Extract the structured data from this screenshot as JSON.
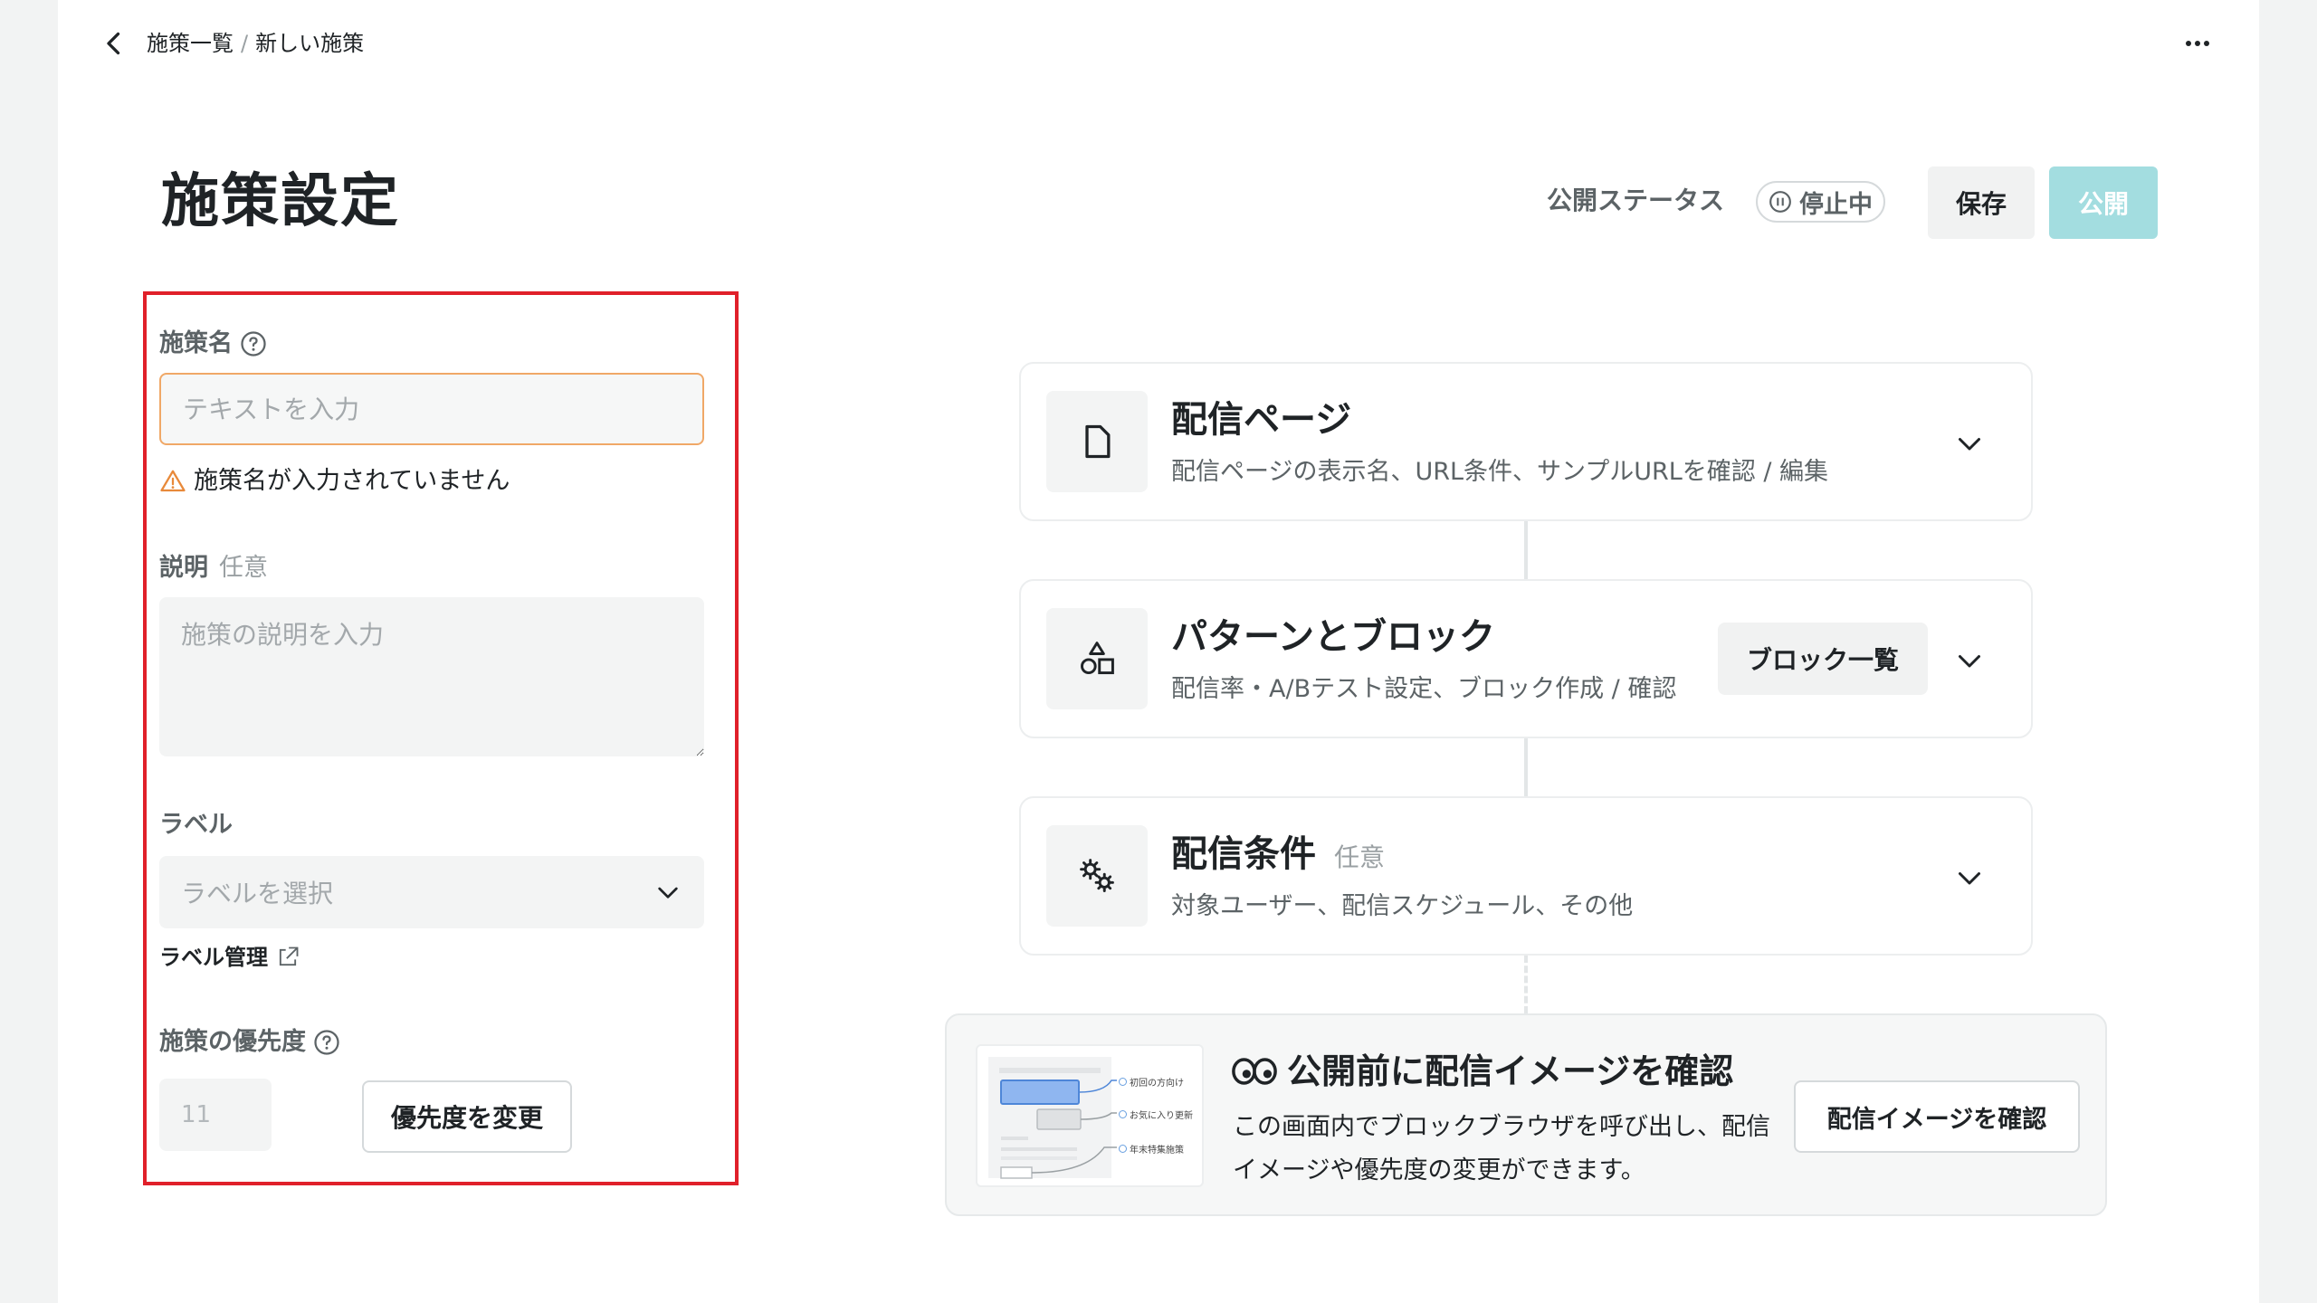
{
  "breadcrumb": {
    "parent": "施策一覧",
    "separator": "/",
    "current": "新しい施策"
  },
  "header": {
    "title": "施策設定",
    "status_label": "公開ステータス",
    "status_value": "停止中",
    "save_label": "保存",
    "publish_label": "公開"
  },
  "form": {
    "name": {
      "label": "施策名",
      "placeholder": "テキストを入力",
      "error": "施策名が入力されていません"
    },
    "description": {
      "label": "説明",
      "optional": "任意",
      "placeholder": "施策の説明を入力"
    },
    "label": {
      "label": "ラベル",
      "placeholder": "ラベルを選択",
      "manage_link": "ラベル管理"
    },
    "priority": {
      "label": "施策の優先度",
      "value": "11",
      "change_button": "優先度を変更"
    }
  },
  "cards": [
    {
      "title": "配信ページ",
      "description": "配信ページの表示名、URL条件、サンプルURLを確認 / 編集",
      "icon": "document-icon"
    },
    {
      "title": "パターンとブロック",
      "description": "配信率・A/Bテスト設定、ブロック作成 / 確認",
      "button": "ブロック一覧",
      "icon": "shapes-icon"
    },
    {
      "title": "配信条件",
      "optional": "任意",
      "description": "対象ユーザー、配信スケジュール、その他",
      "icon": "gears-icon"
    }
  ],
  "preview": {
    "title": "公開前に配信イメージを確認",
    "description": "この画面内でブロックブラウザを呼び出し、配信イメージや優先度の変更ができます。",
    "button": "配信イメージを確認",
    "thumb_items": [
      "初回の方向け",
      "お気に入り更新",
      "年末特集施策"
    ]
  },
  "colors": {
    "accent": "#a3dde0",
    "error_border": "#e0202a",
    "warning": "#f0a867"
  }
}
